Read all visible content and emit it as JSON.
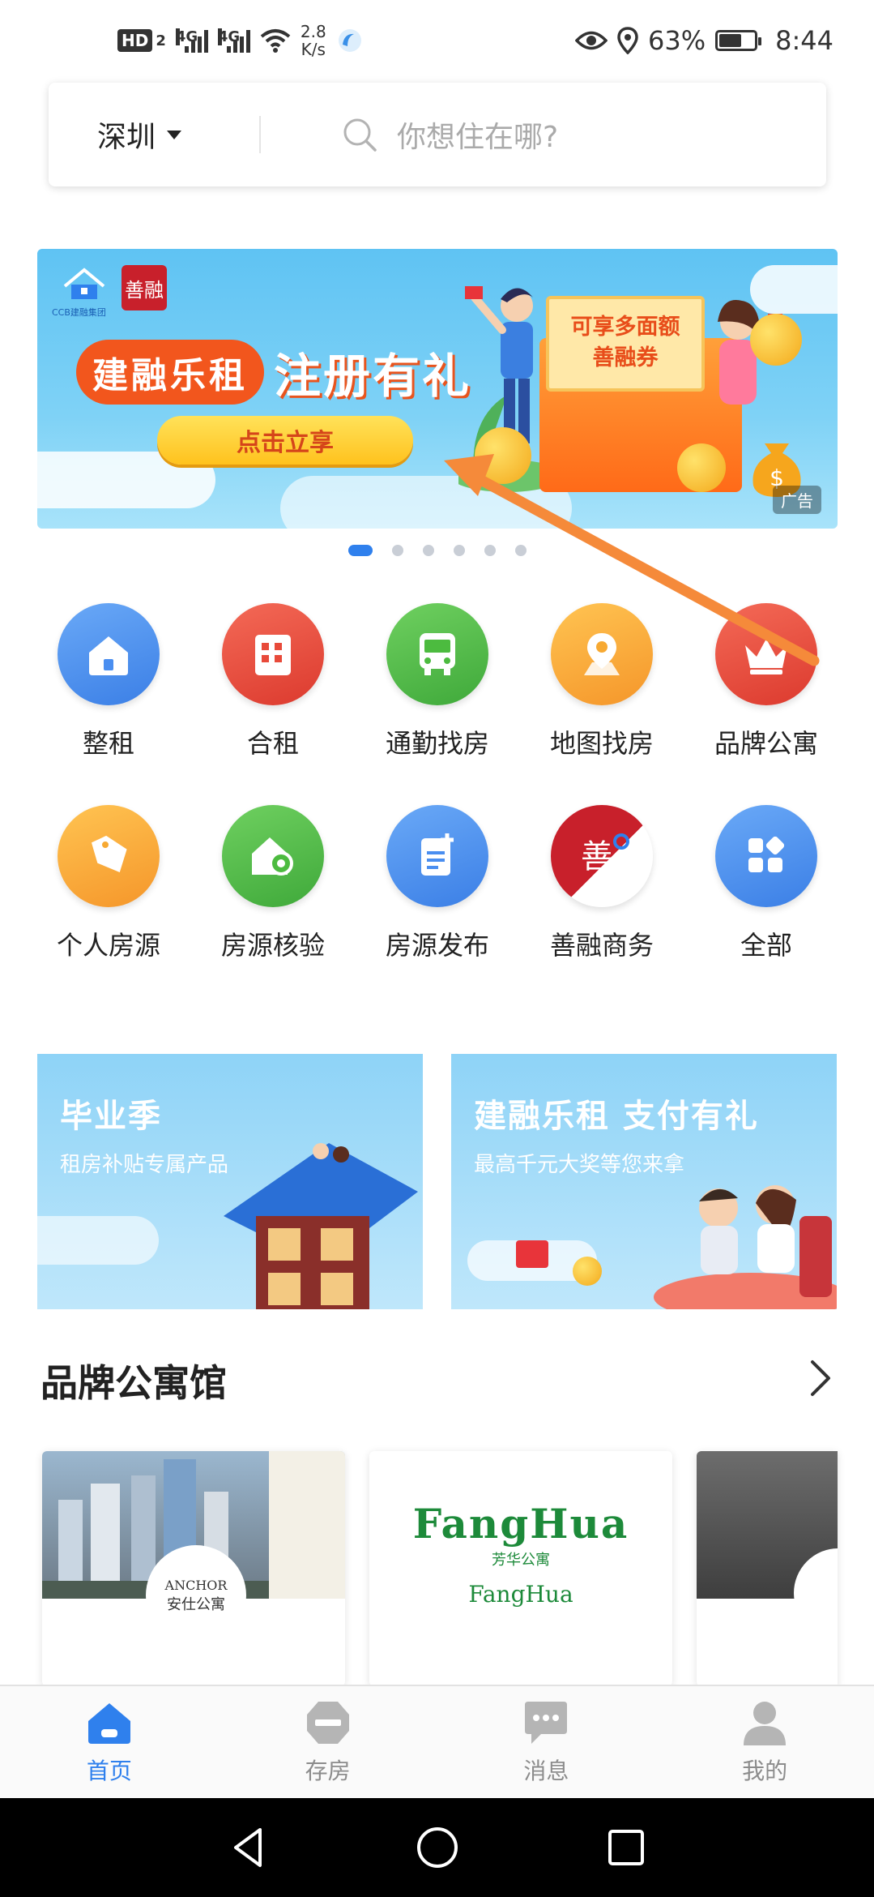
{
  "status_bar": {
    "hd": "HD",
    "hd_sub": "2",
    "network_1": "4G",
    "network_2": "4G",
    "speed_value": "2.8",
    "speed_unit": "K/s",
    "battery": "63%",
    "battery_level": 0.63,
    "time": "8:44"
  },
  "search": {
    "city": "深圳",
    "placeholder": "你想住在哪?"
  },
  "banner": {
    "logo_caption": "CCB建融集团",
    "brand_mark": "善融",
    "title_part1": "建融乐租",
    "title_part2": "注册有礼",
    "cta": "点击立享",
    "note_line1": "可享多面额",
    "note_line2": "善融券",
    "ad_tag": "广告",
    "dots_total": 6,
    "active_dot": 0
  },
  "grid_row1": [
    {
      "label": "整租",
      "icon": "house-icon",
      "color": "#4a8ef0"
    },
    {
      "label": "合租",
      "icon": "building-icon",
      "color": "#e84a3a"
    },
    {
      "label": "通勤找房",
      "icon": "bus-icon",
      "color": "#4cbb3f"
    },
    {
      "label": "地图找房",
      "icon": "map-pin-icon",
      "color": "#f7a932"
    },
    {
      "label": "品牌公寓",
      "icon": "crown-icon",
      "color": "#e8473a"
    }
  ],
  "grid_row2": [
    {
      "label": "个人房源",
      "icon": "tag-icon",
      "color": "#f7a932"
    },
    {
      "label": "房源核验",
      "icon": "house-check-icon",
      "color": "#4cbb3f"
    },
    {
      "label": "房源发布",
      "icon": "doc-add-icon",
      "color": "#4a8ef0"
    },
    {
      "label": "善融商务",
      "icon": "shanrong-logo-icon",
      "color": "#c8202b"
    },
    {
      "label": "全部",
      "icon": "apps-icon",
      "color": "#4a8ef0"
    }
  ],
  "promos": [
    {
      "title": "毕业季",
      "subtitle": "租房补贴专属产品"
    },
    {
      "title": "建融乐租 支付有礼",
      "subtitle": "最高千元大奖等您来拿"
    }
  ],
  "brand_section": {
    "title": "品牌公寓馆",
    "cards": [
      {
        "name": "ANCHOR",
        "name_cn": "安仕公寓"
      },
      {
        "name": "FangHua",
        "name_cn": "芳华公寓"
      },
      {
        "name": "",
        "name_cn": ""
      }
    ]
  },
  "tabs": [
    {
      "label": "首页",
      "icon": "home-icon",
      "active": true
    },
    {
      "label": "存房",
      "icon": "deposit-icon",
      "active": false
    },
    {
      "label": "消息",
      "icon": "message-icon",
      "active": false
    },
    {
      "label": "我的",
      "icon": "profile-icon",
      "active": false
    }
  ],
  "colors": {
    "accent": "#2f80ed",
    "annotation_arrow": "#f58a3a"
  }
}
